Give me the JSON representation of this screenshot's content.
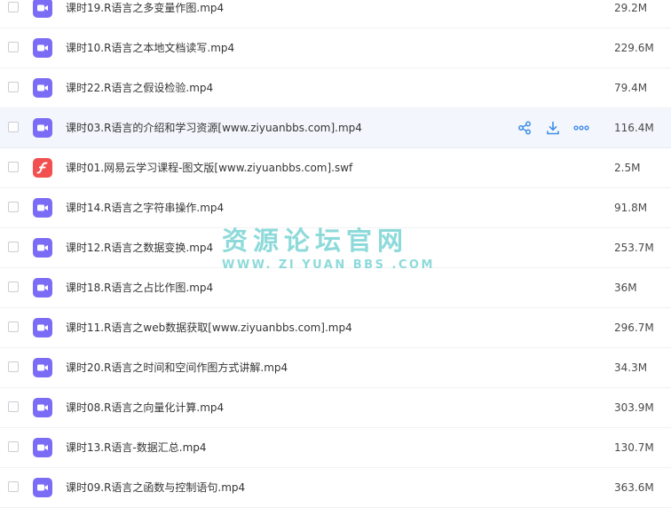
{
  "colors": {
    "video_icon": "#7b6cf6",
    "flash_icon": "#f25050",
    "action_icon": "#3f8ee8",
    "hover_row": "#f3f6fc",
    "watermark": "#48c4c4"
  },
  "files": [
    {
      "name": "课时19.R语言之多变量作图.mp4",
      "size": "29.2M",
      "icon": "video-icon"
    },
    {
      "name": "课时10.R语言之本地文档读写.mp4",
      "size": "229.6M",
      "icon": "video-icon"
    },
    {
      "name": "课时22.R语言之假设检验.mp4",
      "size": "79.4M",
      "icon": "video-icon"
    },
    {
      "name": "课时03.R语言的介绍和学习资源[www.ziyuanbbs.com].mp4",
      "size": "116.4M",
      "icon": "video-icon",
      "hovered": true
    },
    {
      "name": "课时01.网易云学习课程-图文版[www.ziyuanbbs.com].swf",
      "size": "2.5M",
      "icon": "flash-icon"
    },
    {
      "name": "课时14.R语言之字符串操作.mp4",
      "size": "91.8M",
      "icon": "video-icon"
    },
    {
      "name": "课时12.R语言之数据变换.mp4",
      "size": "253.7M",
      "icon": "video-icon"
    },
    {
      "name": "课时18.R语言之占比作图.mp4",
      "size": "36M",
      "icon": "video-icon"
    },
    {
      "name": "课时11.R语言之web数据获取[www.ziyuanbbs.com].mp4",
      "size": "296.7M",
      "icon": "video-icon"
    },
    {
      "name": "课时20.R语言之时间和空间作图方式讲解.mp4",
      "size": "34.3M",
      "icon": "video-icon"
    },
    {
      "name": "课时08.R语言之向量化计算.mp4",
      "size": "303.9M",
      "icon": "video-icon"
    },
    {
      "name": "课时13.R语言-数据汇总.mp4",
      "size": "130.7M",
      "icon": "video-icon"
    },
    {
      "name": "课时09.R语言之函数与控制语句.mp4",
      "size": "363.6M",
      "icon": "video-icon"
    }
  ],
  "row_actions": [
    {
      "name": "share-icon"
    },
    {
      "name": "download-icon"
    },
    {
      "name": "more-icon"
    }
  ],
  "watermark": {
    "title": "资源论坛官网",
    "url": "WWW. ZI YUAN BBS .COM"
  }
}
